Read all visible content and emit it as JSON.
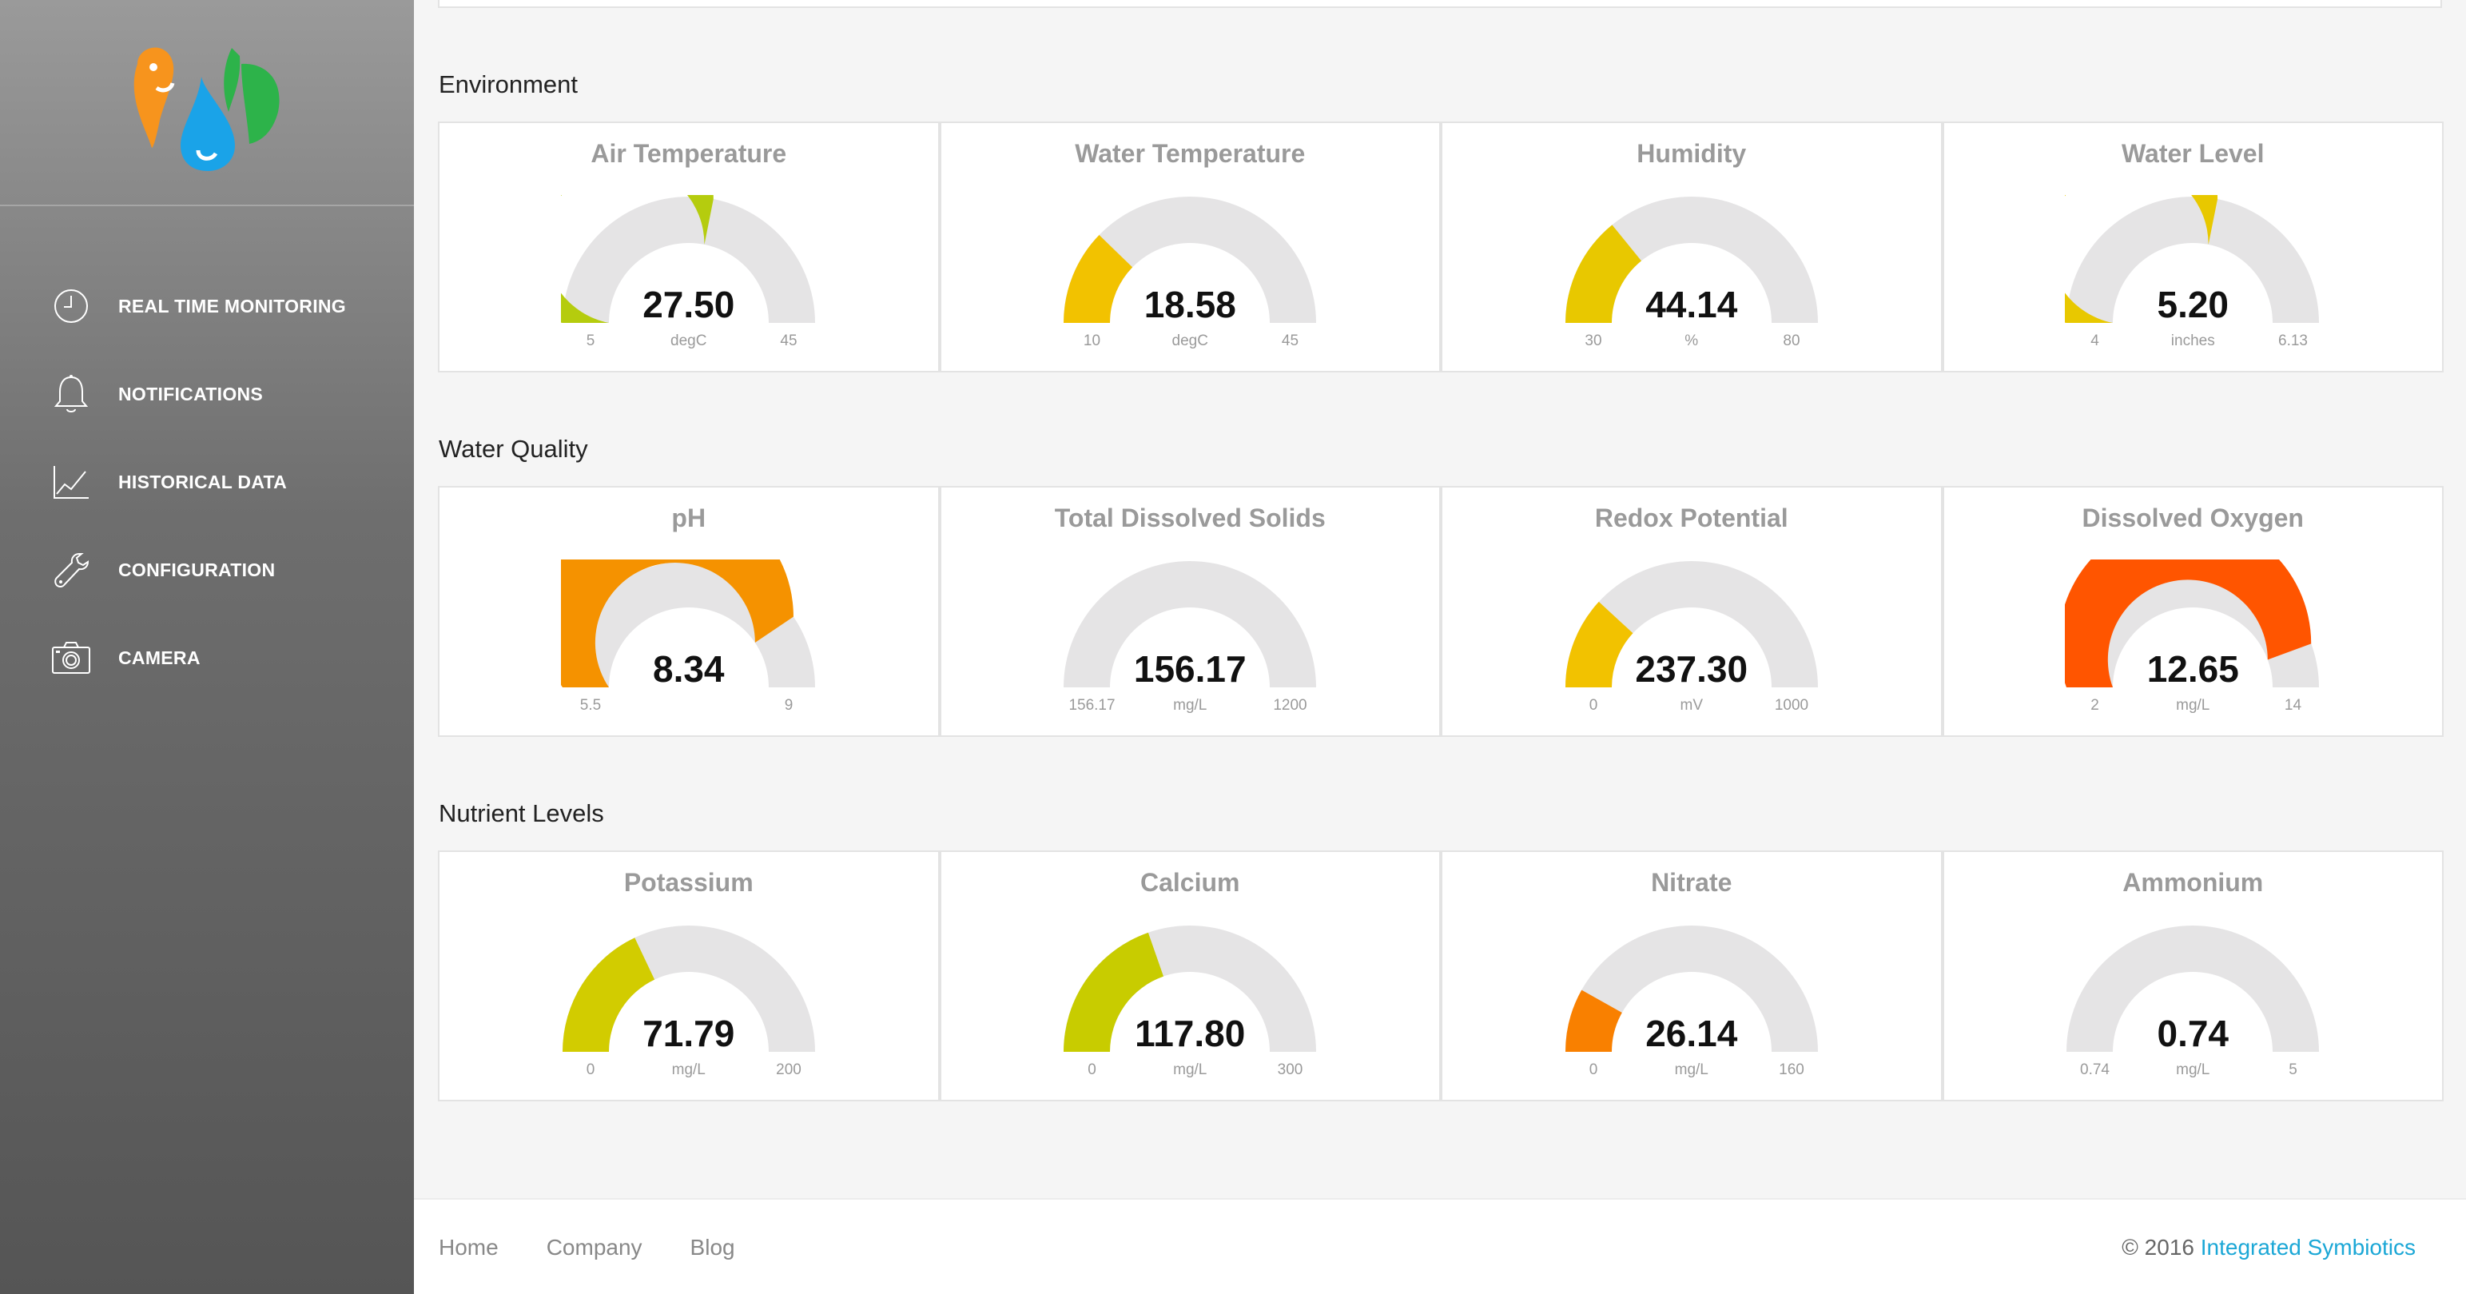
{
  "sidebar": {
    "items": [
      {
        "label": "REAL TIME MONITORING",
        "icon": "clock-icon"
      },
      {
        "label": "NOTIFICATIONS",
        "icon": "bell-icon"
      },
      {
        "label": "HISTORICAL DATA",
        "icon": "line-chart-icon"
      },
      {
        "label": "CONFIGURATION",
        "icon": "wrench-icon"
      },
      {
        "label": "CAMERA",
        "icon": "camera-icon"
      }
    ],
    "logo_colors": {
      "fish": "#f7941d",
      "drop": "#1aa3e8",
      "leaf": "#2db34a"
    }
  },
  "sections": [
    {
      "title": "Environment",
      "gauges": [
        {
          "title": "Air Temperature",
          "value": "27.50",
          "min": "5",
          "max": "45",
          "unit": "degC",
          "fraction": 0.5625,
          "color": "#b5cc0e"
        },
        {
          "title": "Water Temperature",
          "value": "18.58",
          "min": "10",
          "max": "45",
          "unit": "degC",
          "fraction": 0.245,
          "color": "#f2c200"
        },
        {
          "title": "Humidity",
          "value": "44.14",
          "min": "30",
          "max": "80",
          "unit": "%",
          "fraction": 0.283,
          "color": "#e8c800"
        },
        {
          "title": "Water Level",
          "value": "5.20",
          "min": "4",
          "max": "6.13",
          "unit": "inches",
          "fraction": 0.563,
          "color": "#e8c800"
        }
      ]
    },
    {
      "title": "Water Quality",
      "gauges": [
        {
          "title": "pH",
          "value": "8.34",
          "min": "5.5",
          "max": "9",
          "unit": "",
          "fraction": 0.811,
          "color": "#f59200"
        },
        {
          "title": "Total Dissolved Solids",
          "value": "156.17",
          "min": "156.17",
          "max": "1200",
          "unit": "mg/L",
          "fraction": 0.0,
          "color": "#e5e4e5"
        },
        {
          "title": "Redox Potential",
          "value": "237.30",
          "min": "0",
          "max": "1000",
          "unit": "mV",
          "fraction": 0.237,
          "color": "#f2c200"
        },
        {
          "title": "Dissolved Oxygen",
          "value": "12.65",
          "min": "2",
          "max": "14",
          "unit": "mg/L",
          "fraction": 0.8875,
          "color": "#ff5500"
        }
      ]
    },
    {
      "title": "Nutrient Levels",
      "gauges": [
        {
          "title": "Potassium",
          "value": "71.79",
          "min": "0",
          "max": "200",
          "unit": "mg/L",
          "fraction": 0.359,
          "color": "#d2cc00"
        },
        {
          "title": "Calcium",
          "value": "117.80",
          "min": "0",
          "max": "300",
          "unit": "mg/L",
          "fraction": 0.393,
          "color": "#c8cc00"
        },
        {
          "title": "Nitrate",
          "value": "26.14",
          "min": "0",
          "max": "160",
          "unit": "mg/L",
          "fraction": 0.163,
          "color": "#f98000"
        },
        {
          "title": "Ammonium",
          "value": "0.74",
          "min": "0.74",
          "max": "5",
          "unit": "mg/L",
          "fraction": 0.0,
          "color": "#e5e4e5"
        }
      ]
    }
  ],
  "footer": {
    "links": [
      "Home",
      "Company",
      "Blog"
    ],
    "copyright_prefix": "© 2016",
    "company": "Integrated Symbiotics",
    "company_color": "#1ba7d6"
  },
  "gauge_track_color": "#e5e4e5"
}
